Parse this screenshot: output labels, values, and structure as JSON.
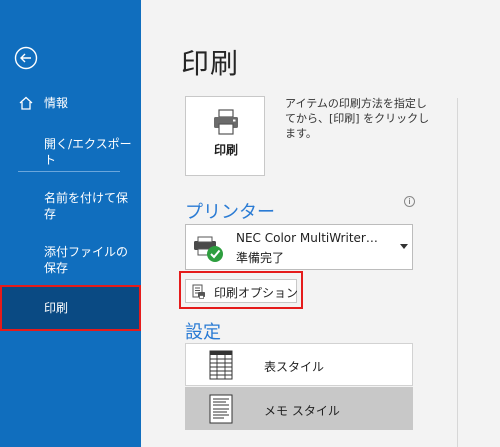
{
  "sidebar": {
    "items": [
      {
        "label": "情報"
      },
      {
        "label": "開く/エクスポート"
      },
      {
        "label": "名前を付けて保存"
      },
      {
        "label": "添付ファイルの保存"
      },
      {
        "label": "印刷"
      }
    ],
    "colors": {
      "background": "#106ebe",
      "active": "#0a4a83",
      "highlight_frame": "#e51b1b"
    }
  },
  "main": {
    "title": "印刷",
    "print_button": {
      "label": "印刷"
    },
    "description": "アイテムの印刷方法を指定してから、[印刷] をクリックします。",
    "printer_section": {
      "heading": "プリンター",
      "info_icon": "i",
      "printer_name": "NEC Color MultiWriter…",
      "printer_status": "準備完了"
    },
    "print_options_label": "印刷オプション",
    "settings_section": {
      "heading": "設定",
      "styles": [
        {
          "label": "表スタイル",
          "icon": "table-style-icon"
        },
        {
          "label": "メモ スタイル",
          "icon": "memo-style-icon"
        }
      ]
    },
    "colors": {
      "accent": "#2a7bd4",
      "selected_row": "#c8c8c8",
      "status_ok": "#2e9e3f"
    }
  }
}
